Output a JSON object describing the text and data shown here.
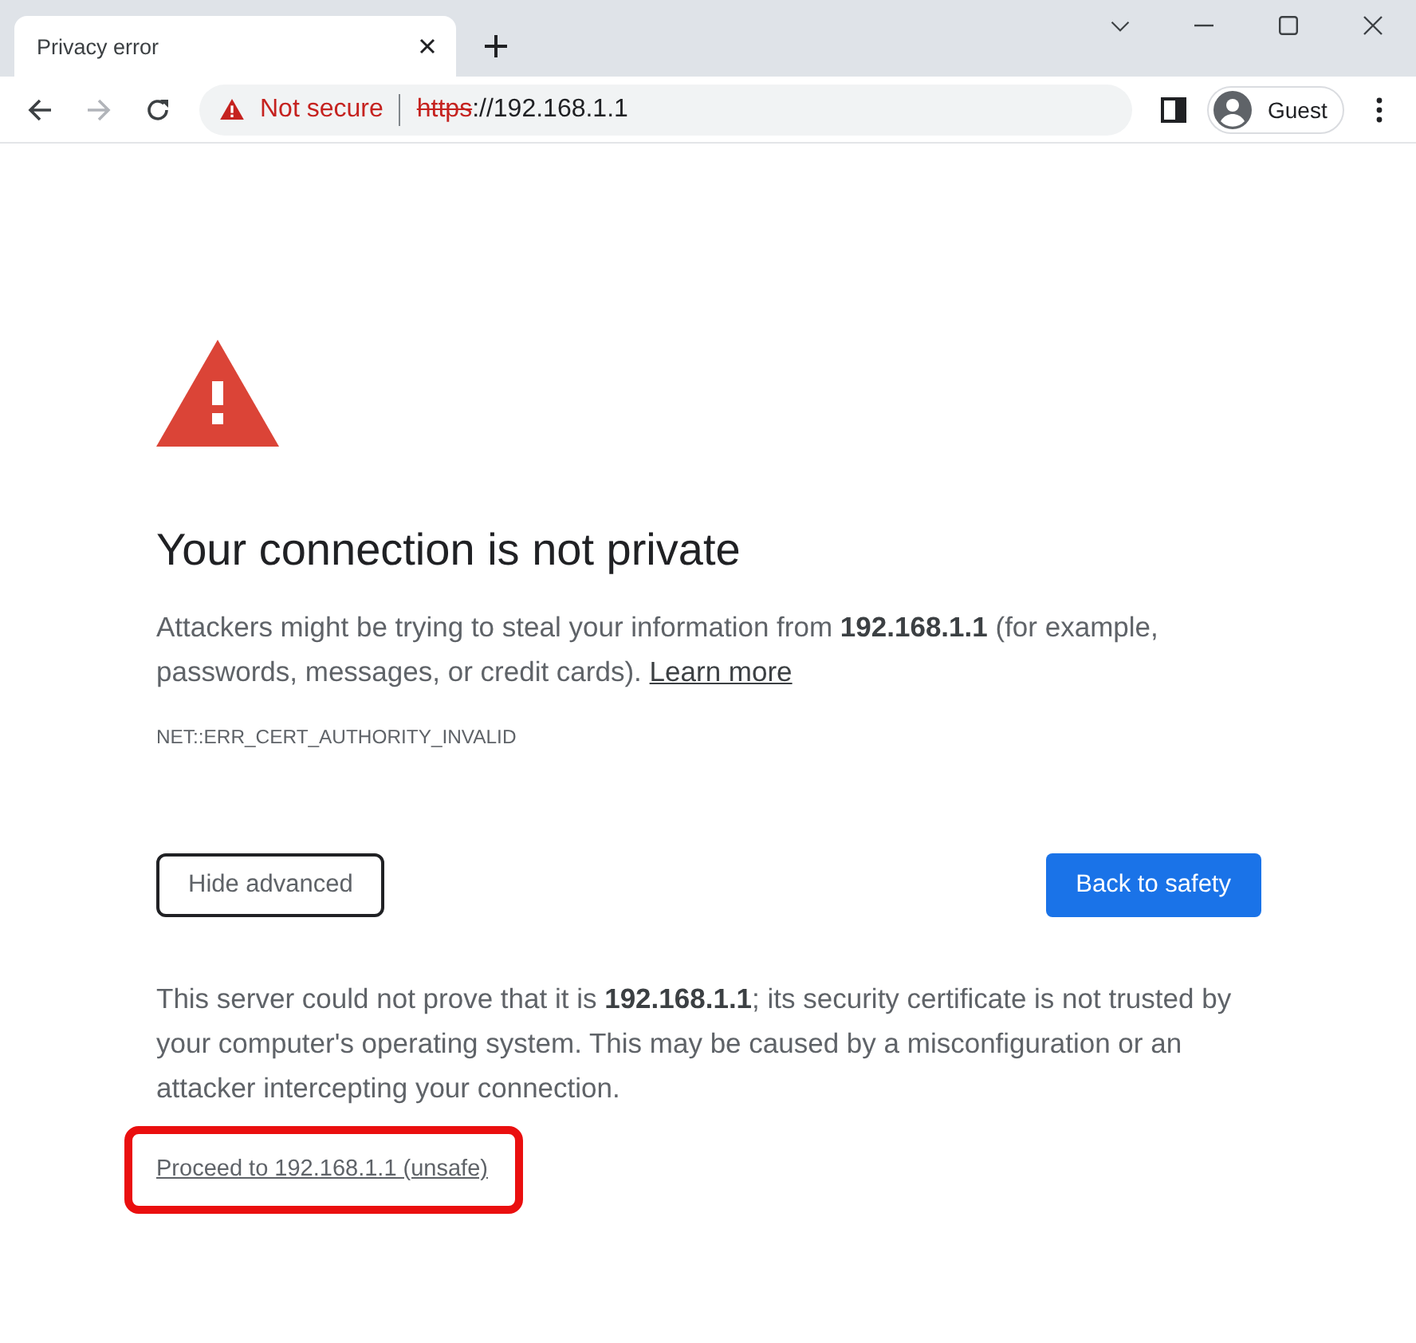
{
  "tabs": [
    {
      "title": "Privacy error",
      "selected": true
    }
  ],
  "toolbar": {
    "nav_buttons": [
      {
        "kind": "back",
        "disabled": false
      },
      {
        "kind": "forward",
        "disabled": true
      },
      {
        "kind": "reload",
        "disabled": false
      }
    ],
    "address_bar": {
      "secure": false,
      "security_label": "Not secure",
      "scheme": "https",
      "rest": "://192.168.1.1"
    },
    "profile": {
      "label": "Guest"
    }
  },
  "content": {
    "heading": "Your connection is not private",
    "summary": "Attackers might be trying to steal your information from **192.168.1.1** (for example, passwords, messages, or credit cards).",
    "learn_more": "Learn more",
    "error_code": "NET::ERR_CERT_AUTHORITY_INVALID",
    "buttons": [
      {
        "label": "Hide advanced",
        "kind": "secondary"
      },
      {
        "label": "Back to safety",
        "kind": "primary"
      }
    ],
    "details": "This server could not prove that it is **192.168.1.1**; its security certificate is not trusted by your computer's operating system. This may be caused by a misconfiguration or an attacker intercepting your connection.",
    "proceed_link": {
      "text": "Proceed to 192.168.1.1 (unsafe)",
      "highlighted": true
    }
  }
}
